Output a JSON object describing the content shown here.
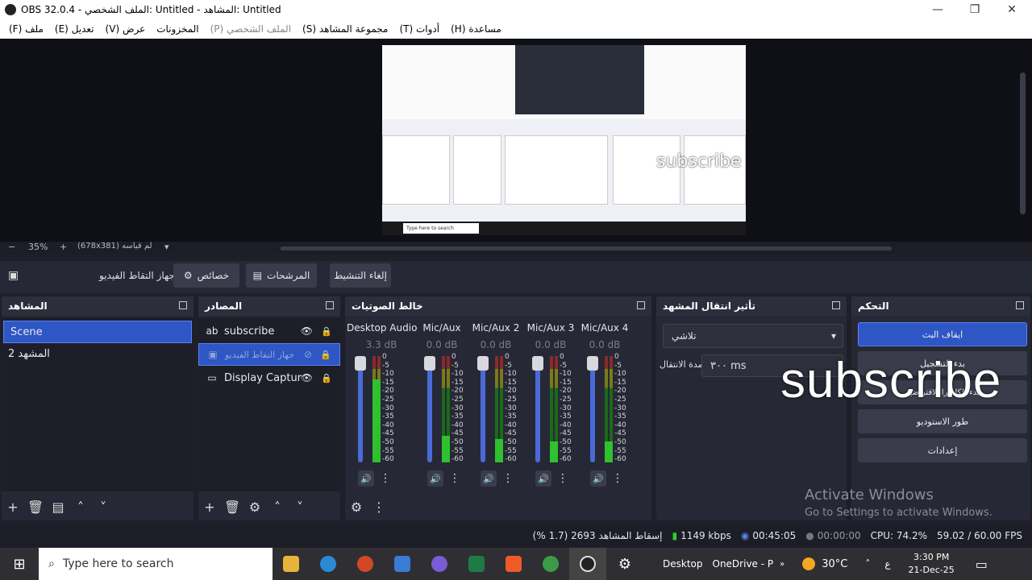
{
  "window": {
    "title": "OBS 32.0.4 - الملف الشخصي: Untitled - المشاهد: Untitled"
  },
  "menu": {
    "items": [
      "(F) ملف",
      "(E) تعديل",
      "(V) عرض",
      "المخزونات",
      "(P) الملف الشخصي",
      "(S) مجموعة المشاهد",
      "(T) أدوات",
      "(H) مساعدة"
    ]
  },
  "preview": {
    "zoom": "35%",
    "size": "(678x381) لم قياسه",
    "overlay_text": "subscribe",
    "inner_search": "Type here to search"
  },
  "toolbar": {
    "source_name": "جهاز التقاط الفيديو",
    "properties": "خصائص",
    "filters": "المرشحات",
    "deactivate": "إلغاء التنشيط"
  },
  "scenes": {
    "title": "المشاهد",
    "items": [
      "Scene",
      "المشهد 2"
    ]
  },
  "sources": {
    "title": "المصادر",
    "items": [
      "subscribe",
      "جهاز التقاط الفيديو",
      "Display Captur"
    ]
  },
  "mixer": {
    "title": "خالط الصوتيات",
    "channels": [
      {
        "name": "Desktop Audio",
        "db": "3.3 dB",
        "level": 0.78
      },
      {
        "name": "Mic/Aux",
        "db": "0.0 dB",
        "level": 0.25
      },
      {
        "name": "Mic/Aux 2",
        "db": "0.0 dB",
        "level": 0.22
      },
      {
        "name": "Mic/Aux 3",
        "db": "0.0 dB",
        "level": 0.2
      },
      {
        "name": "Mic/Aux 4",
        "db": "0.0 dB",
        "level": 0.2
      }
    ],
    "scale": [
      "0",
      "-5",
      "-10",
      "-15",
      "-20",
      "-25",
      "-30",
      "-35",
      "-40",
      "-45",
      "-50",
      "-55",
      "-60"
    ]
  },
  "transitions": {
    "title": "تأثير انتقال المشهد",
    "selected": "تلاشي",
    "duration_label": "مدة الانتقال",
    "duration_value": "٣٠٠ ms"
  },
  "controls": {
    "title": "التحكم",
    "stop_stream": "ايقاف البث",
    "start_record": "بدء التسجيل",
    "virtual_camera": "بدء الكاميرا الافتراضية",
    "studio_mode": "طور الاستوديو",
    "settings": "إعدادات"
  },
  "overlay": {
    "subscribe": "subscribe",
    "activate_title": "Activate Windows",
    "activate_sub": "Go to Settings to activate Windows."
  },
  "status": {
    "dropped": "إسقاط المشاهد 2693 (1.7 %)",
    "bitrate": "1149 kbps",
    "stream_time": "00:45:05",
    "rec_time": "00:00:00",
    "cpu": "CPU: 74.2%",
    "fps": "59.02 / 60.00 FPS"
  },
  "taskbar": {
    "search_placeholder": "Type here to search",
    "desktop": "Desktop",
    "onedrive": "OneDrive - P",
    "weather": "30°C",
    "lang": "ع",
    "time": "3:30 PM",
    "date": "21-Dec-25"
  },
  "colors": {
    "accent": "#2e56c4",
    "panel": "#272835",
    "meter_green": "#2fc12f"
  }
}
